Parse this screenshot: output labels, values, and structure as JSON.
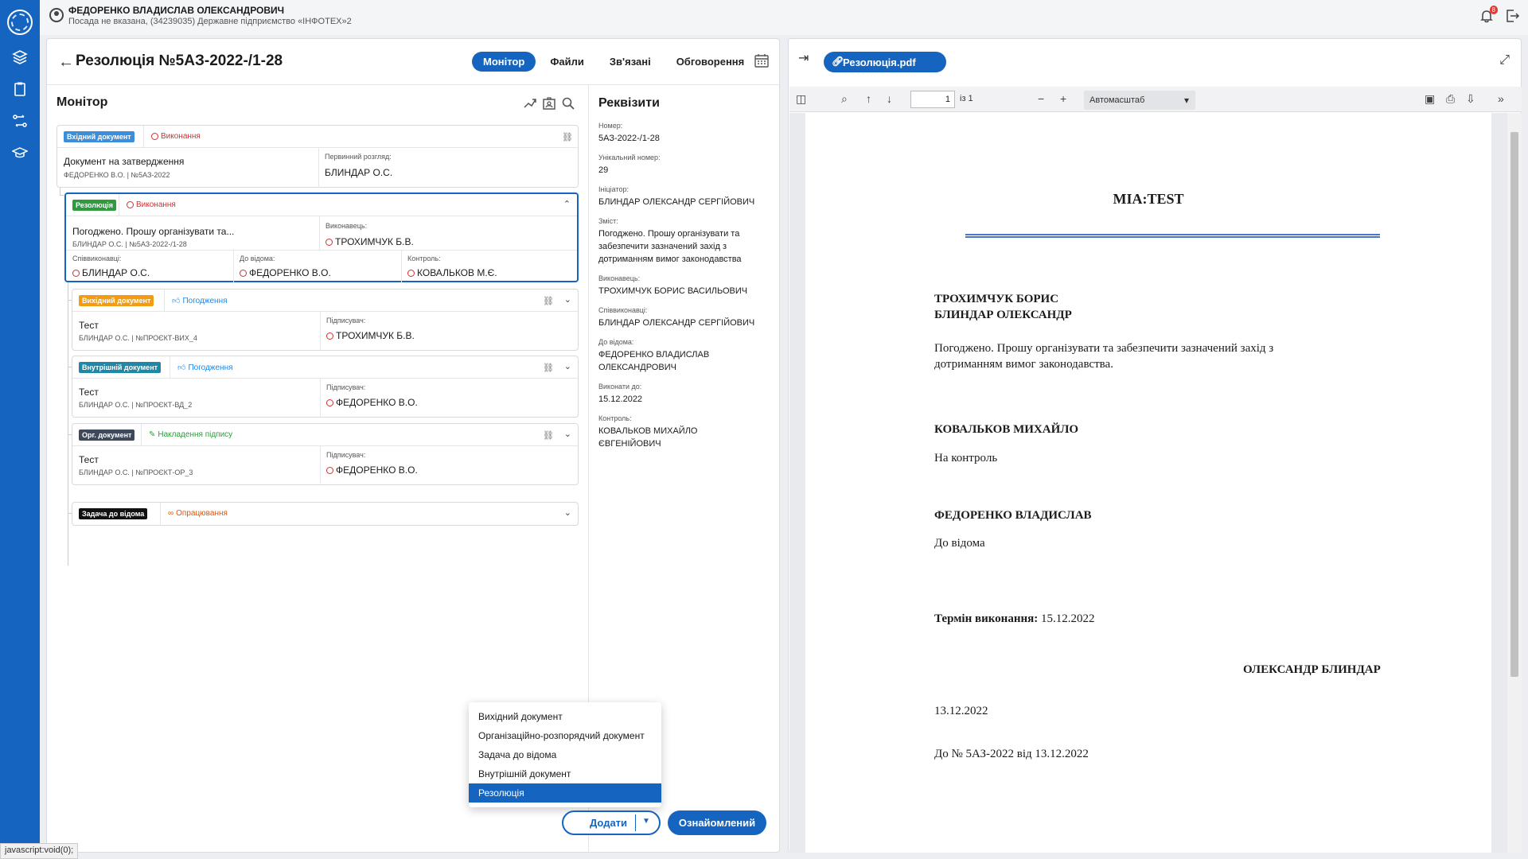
{
  "user": {
    "name": "ФЕДОРЕНКО ВЛАДИСЛАВ ОЛЕКСАНДРОВИЧ",
    "subtitle": "Посада не вказана, (34239035) Державне підприємство «ІНФОТЕХ»2",
    "notifications": "8"
  },
  "document": {
    "title": "Резолюція №5АЗ-2022-/1-28",
    "tabs": [
      "Монітор",
      "Файли",
      "Зв'язані",
      "Обговорення"
    ],
    "active_tab": "Монітор"
  },
  "monitor": {
    "title": "Монітор",
    "root": {
      "tag": "Вхідний документ",
      "status": "Виконання",
      "title": "Документ на затвердження",
      "sub": "ФЕДОРЕНКО В.О. | №5АЗ-2022",
      "review_label": "Первинний розгляд:",
      "review_value": "БЛИНДАР О.С."
    },
    "resolution": {
      "tag": "Резолюція",
      "status": "Виконання",
      "title": "Погоджено. Прошу організувати та...",
      "sub": "БЛИНДАР О.С. | №5АЗ-2022-/1-28",
      "executor_label": "Виконавець:",
      "executor": "ТРОХИМЧУК Б.В.",
      "co_label": "Співвиконавці:",
      "co": "БЛИНДАР О.С.",
      "info_label": "До відома:",
      "info": "ФЕДОРЕНКО В.О.",
      "control_label": "Контроль:",
      "control": "КОВАЛЬКОВ М.Є."
    },
    "children": [
      {
        "tag": "Вихідний документ",
        "status": "Погодження",
        "title": "Тест",
        "sub": "БЛИНДАР О.С. | №ПРОЄКТ-ВИХ_4",
        "signer_label": "Підписувач:",
        "signer": "ТРОХИМЧУК Б.В."
      },
      {
        "tag": "Внутрішній документ",
        "status": "Погодження",
        "title": "Тест",
        "sub": "БЛИНДАР О.С. | №ПРОЄКТ-ВД_2",
        "signer_label": "Підписувач:",
        "signer": "ФЕДОРЕНКО В.О."
      },
      {
        "tag": "Орг. документ",
        "status": "Накладення підпису",
        "title": "Тест",
        "sub": "БЛИНДАР О.С. | №ПРОЄКТ-ОР_3",
        "signer_label": "Підписувач:",
        "signer": "ФЕДОРЕНКО В.О."
      },
      {
        "tag": "Задача до відома",
        "status": "Опрацювання"
      }
    ]
  },
  "requisites": {
    "title": "Реквізити",
    "items": [
      {
        "label": "Номер:",
        "value": "5АЗ-2022-/1-28"
      },
      {
        "label": "Унікальний номер:",
        "value": "29"
      },
      {
        "label": "Ініціатор:",
        "value": "БЛИНДАР ОЛЕКСАНДР СЕРГІЙОВИЧ"
      },
      {
        "label": "Зміст:",
        "value": "Погоджено. Прошу організувати та забезпечити зазначений захід з дотриманням вимог законодавства"
      },
      {
        "label": "Виконавець:",
        "value": "ТРОХИМЧУК БОРИС ВАСИЛЬОВИЧ"
      },
      {
        "label": "Співвиконавці:",
        "value": "БЛИНДАР ОЛЕКСАНДР СЕРГІЙОВИЧ"
      },
      {
        "label": "До відома:",
        "value": "ФЕДОРЕНКО ВЛАДИСЛАВ ОЛЕКСАНДРОВИЧ"
      },
      {
        "label": "Виконати до:",
        "value": "15.12.2022"
      },
      {
        "label": "Контроль:",
        "value": "КОВАЛЬКОВ МИХАЙЛО ЄВГЕНІЙОВИЧ"
      }
    ]
  },
  "dropdown": {
    "items": [
      "Вихідний документ",
      "Організаційно-розпорядчий документ",
      "Задача до відома",
      "Внутрішній документ",
      "Резолюція"
    ],
    "selected": "Резолюція"
  },
  "actions": {
    "add": "Додати",
    "acknowledge": "Ознайомлений"
  },
  "pdf": {
    "tab": "Резолюція.pdf",
    "page": "1",
    "page_of": "із 1",
    "zoom": "Автомасштаб",
    "content": {
      "title": "МІА:TEST",
      "addressee_1": "ТРОХИМЧУК БОРИС",
      "addressee_2": "БЛИНДАР ОЛЕКСАНДР",
      "body_1": "Погоджено. Прошу організувати та забезпечити зазначений захід з",
      "body_2": "дотриманням вимог законодавства.",
      "control_name": "КОВАЛЬКОВ МИХАЙЛО",
      "control_text": "На контроль",
      "info_name": "ФЕДОРЕНКО ВЛАДИСЛАВ",
      "info_text": "До відома",
      "deadline_label": "Термін виконання:",
      "deadline_value": "15.12.2022",
      "signer": "ОЛЕКСАНДР БЛИНДАР",
      "date": "13.12.2022",
      "ref": "До № 5АЗ-2022 від 13.12.2022"
    }
  },
  "statusbar": "javascript:void(0);",
  "colors": {
    "accent": "#1565c0",
    "status_red": "#d32f2f",
    "tag_green": "#2e9b3f",
    "tag_orange": "#f39c12"
  }
}
